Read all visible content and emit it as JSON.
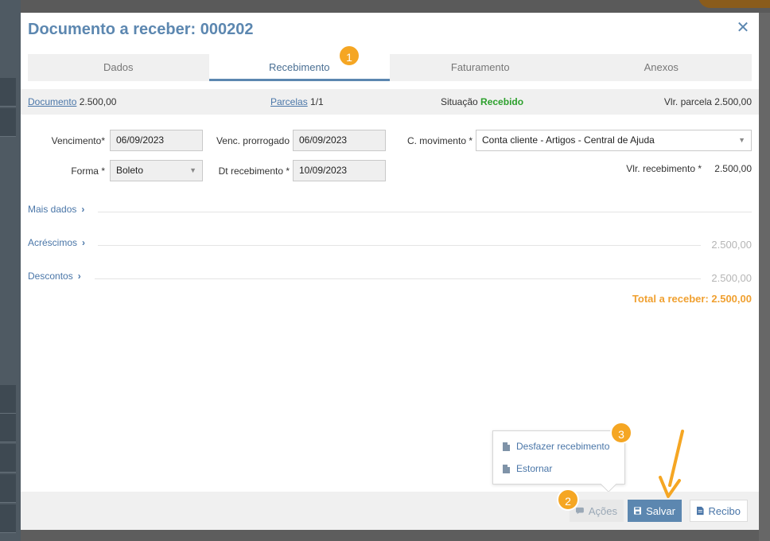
{
  "modal": {
    "title": "Documento a receber: 000202",
    "close_icon": "close-icon"
  },
  "tabs": [
    {
      "label": "Dados",
      "active": false
    },
    {
      "label": "Recebimento",
      "active": true
    },
    {
      "label": "Faturamento",
      "active": false
    },
    {
      "label": "Anexos",
      "active": false
    }
  ],
  "badges": {
    "one": "1",
    "two": "2",
    "three": "3"
  },
  "info_bar": {
    "documento_link": "Documento",
    "documento_value": "2.500,00",
    "parcelas_link": "Parcelas",
    "parcelas_value": "1/1",
    "situacao_label": "Situação",
    "situacao_value": "Recebido",
    "vlr_parcela_label": "Vlr. parcela",
    "vlr_parcela_value": "2.500,00"
  },
  "form": {
    "vencimento_label": "Vencimento*",
    "vencimento_value": "06/09/2023",
    "venc_prorrogado_label": "Venc. prorrogado",
    "venc_prorrogado_value": "06/09/2023",
    "c_movimento_label": "C. movimento *",
    "c_movimento_value": "Conta cliente - Artigos - Central de Ajuda",
    "forma_label": "Forma *",
    "forma_value": "Boleto",
    "dt_recebimento_label": "Dt recebimento *",
    "dt_recebimento_value": "10/09/2023",
    "vlr_recebimento_label": "Vlr. recebimento *",
    "vlr_recebimento_value": "2.500,00"
  },
  "sections": {
    "mais_dados": "Mais dados",
    "acrescimos": "Acréscimos",
    "acrescimos_value": "2.500,00",
    "descontos": "Descontos",
    "descontos_value": "2.500,00"
  },
  "total": "Total a receber: 2.500,00",
  "popover": {
    "desfazer": "Desfazer recebimento",
    "estornar": "Estornar"
  },
  "footer": {
    "acoes": "Ações",
    "salvar": "Salvar",
    "recibo": "Recibo"
  },
  "colors": {
    "accent": "#5c87b0",
    "badge": "#f5a623",
    "success": "#2ca02c",
    "total": "#f0a030"
  }
}
